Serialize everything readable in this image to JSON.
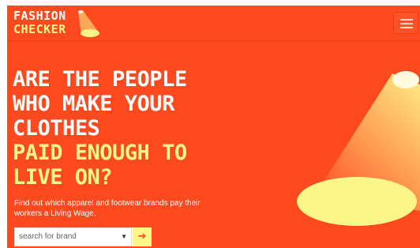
{
  "brand": {
    "line1": "FASHION",
    "line2": "CHECKER",
    "primary_color": "#ff4a1f",
    "accent_color": "#fff68a"
  },
  "header": {
    "menu_icon": "hamburger-menu-icon"
  },
  "hero": {
    "headline_white": [
      "ARE THE PEOPLE",
      "WHO MAKE YOUR",
      "CLOTHES"
    ],
    "headline_yellow": [
      "PAID ENOUGH TO",
      "LIVE ON?"
    ],
    "subtitle": "Find out which apparel and footwear brands pay their workers a Living Wage."
  },
  "search": {
    "placeholder": "search for brand",
    "dropdown_icon": "caret-down-icon",
    "submit_icon": "arrow-right-icon"
  },
  "illustration": {
    "name": "spotlight-illustration"
  }
}
